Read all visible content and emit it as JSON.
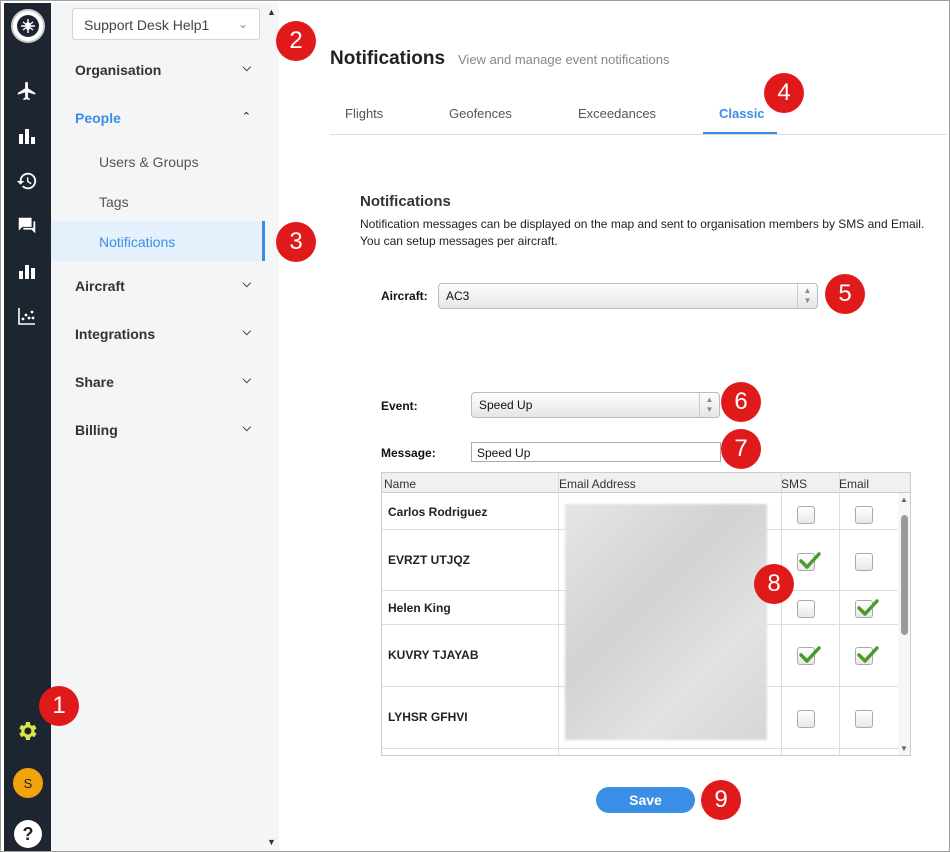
{
  "org_selector": {
    "value": "Support Desk Help1"
  },
  "nav": {
    "groups": [
      {
        "label": "Organisation"
      },
      {
        "label": "People"
      },
      {
        "label": "Aircraft"
      },
      {
        "label": "Integrations"
      },
      {
        "label": "Share"
      },
      {
        "label": "Billing"
      }
    ],
    "people_items": [
      {
        "label": "Users & Groups"
      },
      {
        "label": "Tags"
      },
      {
        "label": "Notifications"
      }
    ]
  },
  "user": {
    "avatar_initial": "S"
  },
  "help": {
    "label": "?"
  },
  "header": {
    "title": "Notifications",
    "subtitle": "View and manage event notifications"
  },
  "tabs": [
    {
      "label": "Flights"
    },
    {
      "label": "Geofences"
    },
    {
      "label": "Exceedances"
    },
    {
      "label": "Classic"
    }
  ],
  "section": {
    "title": "Notifications",
    "description_line1": "Notification messages can be displayed on the map and sent to organisation members by SMS and Email.",
    "description_line2": "You can setup messages per aircraft."
  },
  "form": {
    "aircraft_label": "Aircraft:",
    "aircraft_value": "AC3",
    "event_label": "Event:",
    "event_value": "Speed Up",
    "message_label": "Message:",
    "message_value": "Speed Up"
  },
  "table": {
    "headers": {
      "name": "Name",
      "email": "Email Address",
      "sms": "SMS",
      "email_col": "Email"
    },
    "rows": [
      {
        "name": "Carlos Rodriguez",
        "sms": false,
        "email": false
      },
      {
        "name": "EVRZT UTJQZ",
        "sms": true,
        "email": false
      },
      {
        "name": "Helen King",
        "sms": false,
        "email": true
      },
      {
        "name": "KUVRY TJAYAB",
        "sms": true,
        "email": true
      },
      {
        "name": "LYHSR GFHVI",
        "sms": false,
        "email": false
      }
    ]
  },
  "actions": {
    "save_label": "Save"
  },
  "callouts": [
    "1",
    "2",
    "3",
    "4",
    "5",
    "6",
    "7",
    "8",
    "9"
  ],
  "colors": {
    "rail": "#1d2530",
    "accent": "#3a8ee6",
    "callout": "#e01a1a",
    "gear": "#d8e34a"
  }
}
